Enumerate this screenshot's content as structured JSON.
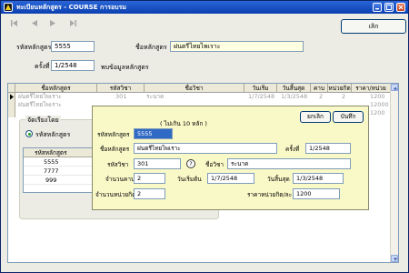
{
  "window": {
    "title": "ทะเบียนหลักสูตร - COURSE การอบรม",
    "exit_label": "เลิก"
  },
  "form": {
    "course_code_label": "รหัสหลักสูตร",
    "course_code_value": "5555",
    "course_name_label": "ชื่อหลักสูตร",
    "course_name_value": "ฝนตรีไทยไพเราะ",
    "round_label": "ครั้งที่",
    "round_value": "1/2548",
    "course_info_label": "พบข้อมูลหลักสูตร"
  },
  "grid": {
    "headers": [
      "ชื่อหลักสูตร",
      "รหัสวิชา",
      "ชื่อวิชา",
      "วันเริ่ม",
      "วันสิ้นสุด",
      "คาบ",
      "หน่วยกิต",
      "ราคา/หน่วย"
    ],
    "rows": [
      [
        "ฝนตรีไทยไพเราะ",
        "301",
        "ระนาด",
        "1/7/2548",
        "1/3/2548",
        "2",
        "2",
        "1200"
      ],
      [
        "ฝนตรีไทยไพเราะ",
        "",
        "",
        "",
        "",
        "",
        "",
        "12000"
      ],
      [
        "",
        "",
        "",
        "",
        "",
        "",
        "",
        "1200"
      ]
    ]
  },
  "sort_group": {
    "title": "จัดเรียงโดย",
    "option_label": "รหัสหลักสูตร",
    "table_header": "รหัสหลักสูตร",
    "table_rows": [
      "5555",
      "7777",
      "999"
    ]
  },
  "dialog": {
    "hint": "( ไม่เกิน 10 หลัก )",
    "course_code_label": "รหัสหลักสูตร",
    "course_code_value": "5555",
    "course_name_label": "ชื่อหลักสูตร",
    "course_name_value": "ฝนตรีไทยไพเราะ",
    "round_label": "ครั้งที่",
    "round_value": "1/2548",
    "subject_code_label": "รหัสวิชา",
    "subject_code_value": "301",
    "help_label": "?",
    "subject_name_label": "ชื่อวิชา",
    "subject_name_value": "ระนาด",
    "periods_label": "จำนวนคาบ",
    "periods_value": "2",
    "start_label": "วันเริ่มต้น",
    "start_value": "1/7/2548",
    "end_label": "วันสิ้นสุด",
    "end_value": "1/3/2548",
    "credits_label": "จำนวนหน่วยกิต",
    "credits_value": "2",
    "price_label": "ราคาหน่วยกิต/ละ",
    "price_value": "1200",
    "cancel_label": "ยกเลิก",
    "save_label": "บันทึก"
  }
}
